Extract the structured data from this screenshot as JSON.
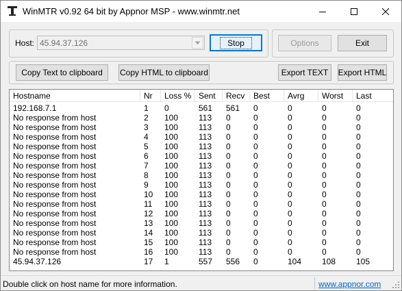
{
  "window": {
    "title": "WinMTR v0.92 64 bit by Appnor MSP - www.winmtr.net"
  },
  "host": {
    "label": "Host:",
    "value": "45.94.37.126"
  },
  "buttons": {
    "stop": "Stop",
    "options": "Options",
    "exit": "Exit",
    "copy_text": "Copy Text to clipboard",
    "copy_html": "Copy HTML to clipboard",
    "export_text": "Export TEXT",
    "export_html": "Export HTML"
  },
  "table": {
    "columns": [
      "Hostname",
      "Nr",
      "Loss %",
      "Sent",
      "Recv",
      "Best",
      "Avrg",
      "Worst",
      "Last"
    ],
    "rows": [
      [
        "192.168.7.1",
        "1",
        "0",
        "561",
        "561",
        "0",
        "0",
        "0",
        "0"
      ],
      [
        "No response from host",
        "2",
        "100",
        "113",
        "0",
        "0",
        "0",
        "0",
        "0"
      ],
      [
        "No response from host",
        "3",
        "100",
        "113",
        "0",
        "0",
        "0",
        "0",
        "0"
      ],
      [
        "No response from host",
        "4",
        "100",
        "113",
        "0",
        "0",
        "0",
        "0",
        "0"
      ],
      [
        "No response from host",
        "5",
        "100",
        "113",
        "0",
        "0",
        "0",
        "0",
        "0"
      ],
      [
        "No response from host",
        "6",
        "100",
        "113",
        "0",
        "0",
        "0",
        "0",
        "0"
      ],
      [
        "No response from host",
        "7",
        "100",
        "113",
        "0",
        "0",
        "0",
        "0",
        "0"
      ],
      [
        "No response from host",
        "8",
        "100",
        "113",
        "0",
        "0",
        "0",
        "0",
        "0"
      ],
      [
        "No response from host",
        "9",
        "100",
        "113",
        "0",
        "0",
        "0",
        "0",
        "0"
      ],
      [
        "No response from host",
        "10",
        "100",
        "113",
        "0",
        "0",
        "0",
        "0",
        "0"
      ],
      [
        "No response from host",
        "11",
        "100",
        "113",
        "0",
        "0",
        "0",
        "0",
        "0"
      ],
      [
        "No response from host",
        "12",
        "100",
        "113",
        "0",
        "0",
        "0",
        "0",
        "0"
      ],
      [
        "No response from host",
        "13",
        "100",
        "113",
        "0",
        "0",
        "0",
        "0",
        "0"
      ],
      [
        "No response from host",
        "14",
        "100",
        "113",
        "0",
        "0",
        "0",
        "0",
        "0"
      ],
      [
        "No response from host",
        "15",
        "100",
        "113",
        "0",
        "0",
        "0",
        "0",
        "0"
      ],
      [
        "No response from host",
        "16",
        "100",
        "113",
        "0",
        "0",
        "0",
        "0",
        "0"
      ],
      [
        "45.94.37.126",
        "17",
        "1",
        "557",
        "556",
        "0",
        "104",
        "108",
        "105"
      ]
    ]
  },
  "statusbar": {
    "message": "Double click on host name for more information.",
    "link": "www.appnor.com"
  },
  "icons": {
    "app": "winmtr-app-icon",
    "minimize": "minimize-icon",
    "maximize": "maximize-icon",
    "close": "close-icon",
    "dropdown": "chevron-down-icon",
    "grip": "resize-grip-icon"
  },
  "colors": {
    "accent": "#0078d7",
    "link": "#0066cc"
  }
}
